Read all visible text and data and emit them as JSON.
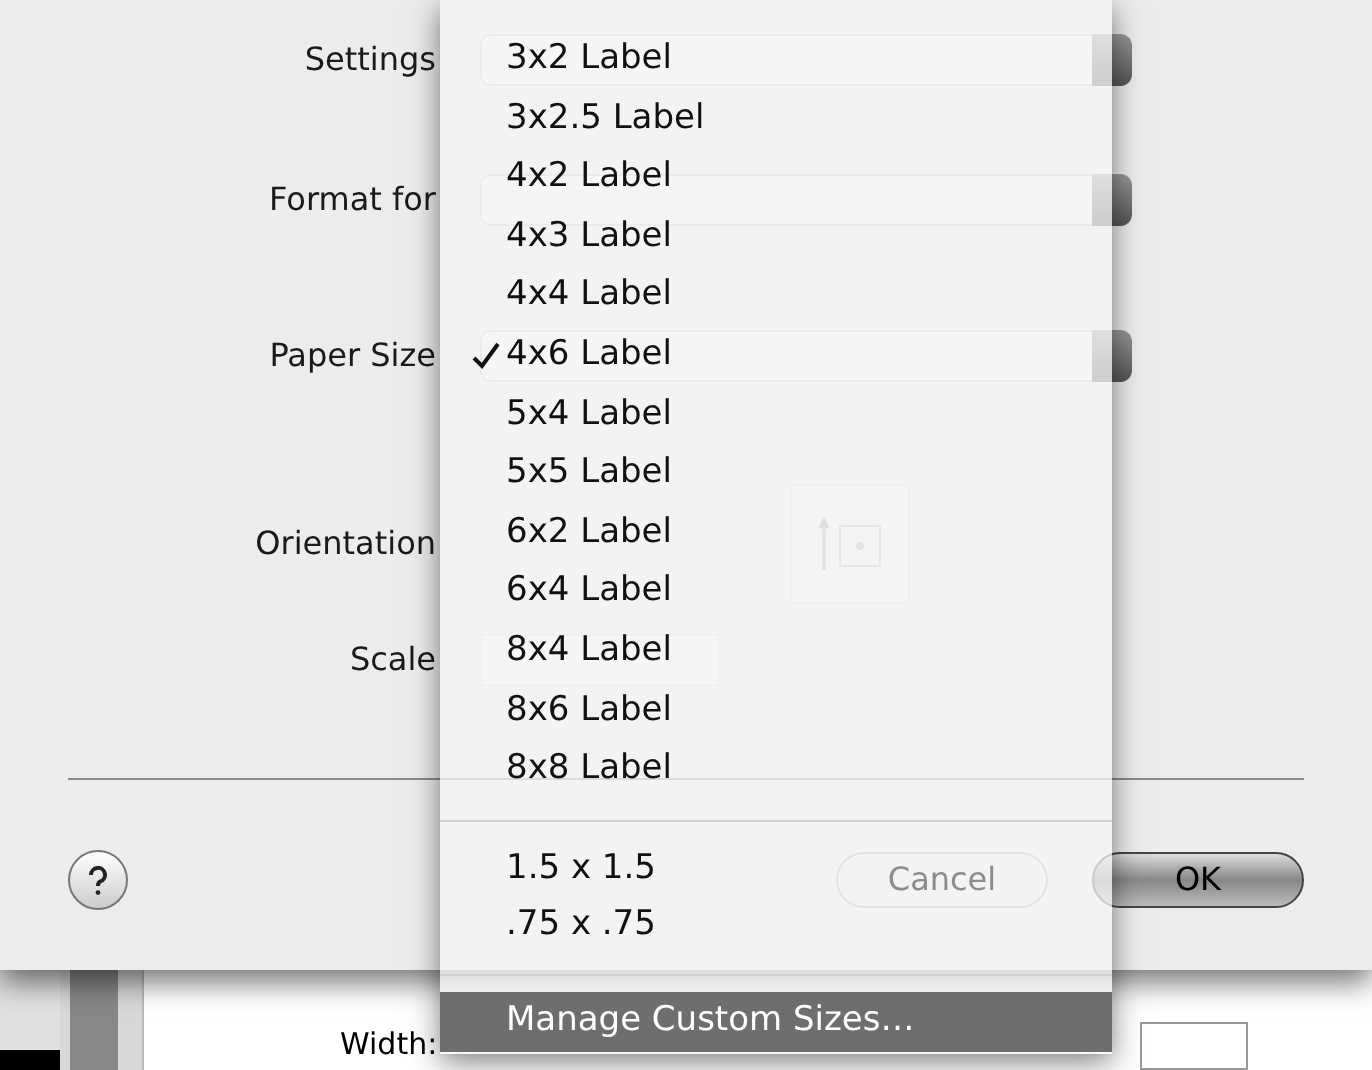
{
  "dialog": {
    "rows": [
      {
        "label": "Settings",
        "kind": "popup"
      },
      {
        "label": "Format for",
        "kind": "popup"
      },
      {
        "label": "Paper Size",
        "kind": "popup"
      },
      {
        "label": "Orientation",
        "kind": "orientation"
      },
      {
        "label": "Scale",
        "kind": "field"
      }
    ],
    "buttons": [
      {
        "label": "Cancel",
        "disabled": true,
        "default": false
      },
      {
        "label": "OK",
        "disabled": false,
        "default": true
      }
    ]
  },
  "menu": {
    "groups": [
      {
        "items": [
          {
            "label": "3x2 Label",
            "checked": false,
            "highlighted": false
          },
          {
            "label": "3x2.5 Label",
            "checked": false,
            "highlighted": false
          },
          {
            "label": "4x2 Label",
            "checked": false,
            "highlighted": false
          },
          {
            "label": "4x3 Label",
            "checked": false,
            "highlighted": false
          },
          {
            "label": "4x4 Label",
            "checked": false,
            "highlighted": false
          },
          {
            "label": "4x6 Label",
            "checked": true,
            "highlighted": false
          },
          {
            "label": "5x4 Label",
            "checked": false,
            "highlighted": false
          },
          {
            "label": "5x5 Label",
            "checked": false,
            "highlighted": false
          },
          {
            "label": "6x2 Label",
            "checked": false,
            "highlighted": false
          },
          {
            "label": "6x4 Label",
            "checked": false,
            "highlighted": false
          },
          {
            "label": "8x4 Label",
            "checked": false,
            "highlighted": false
          },
          {
            "label": "8x6 Label",
            "checked": false,
            "highlighted": false
          },
          {
            "label": "8x8 Label",
            "checked": false,
            "highlighted": false
          }
        ]
      },
      {
        "items": [
          {
            "label": "1.5 x 1.5",
            "checked": false,
            "highlighted": false
          },
          {
            "label": ".75 x .75",
            "checked": false,
            "highlighted": false
          }
        ]
      },
      {
        "items": [
          {
            "label": "Manage Custom Sizes…",
            "checked": false,
            "highlighted": true
          }
        ]
      }
    ]
  },
  "background_window": {
    "width_label": "Width:"
  }
}
